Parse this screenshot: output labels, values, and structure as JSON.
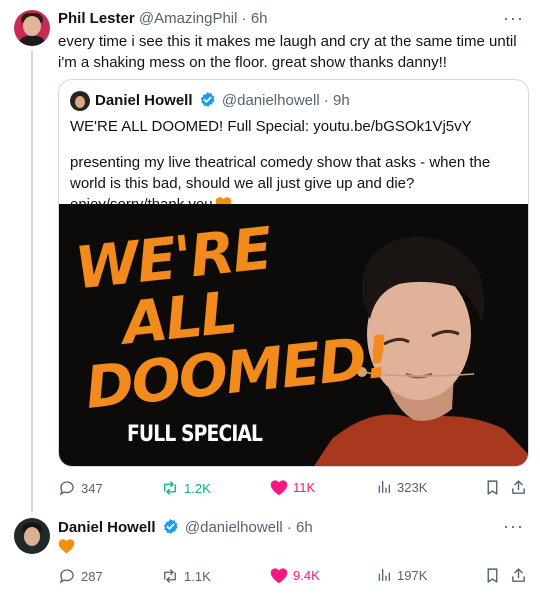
{
  "post": {
    "author_name": "Phil Lester",
    "handle": "@AmazingPhil",
    "time": "6h",
    "more": "···",
    "text": "every time i see this it makes me laugh and cry at the same time until i'm a shaking mess on the floor. great show thanks danny!!"
  },
  "quote": {
    "author_name": "Daniel Howell",
    "handle": "@danielhowell",
    "time": "9h",
    "line1": "WE'RE ALL DOOMED! Full Special: youtu.be/bGSOk1Vj5vY",
    "line2": "presenting my live theatrical comedy show that asks - when the world is this bad, should we all just give up and die? enjoy/sorry/thank you",
    "media": {
      "title_lines": [
        "WE'RE",
        "ALL",
        "DOOMED!"
      ],
      "subtitle": "FULL SPECIAL"
    }
  },
  "post_actions": {
    "replies": "347",
    "reposts": "1.2K",
    "likes": "11K",
    "views": "323K"
  },
  "reply": {
    "author_name": "Daniel Howell",
    "handle": "@danielhowell",
    "time": "6h",
    "more": "···"
  },
  "reply_actions": {
    "replies": "287",
    "reposts": "1.1K",
    "likes": "9.4K",
    "views": "197K"
  },
  "colors": {
    "verified": "#1d9bf0",
    "like": "#f91880",
    "repost": "#00ba7c",
    "heart_emoji": "#f4900c",
    "accent_title": "#f28a1c"
  },
  "icons": [
    "reply-icon",
    "repost-icon",
    "like-icon",
    "views-icon",
    "bookmark-icon",
    "share-icon",
    "verified-icon",
    "orange-heart-icon"
  ]
}
